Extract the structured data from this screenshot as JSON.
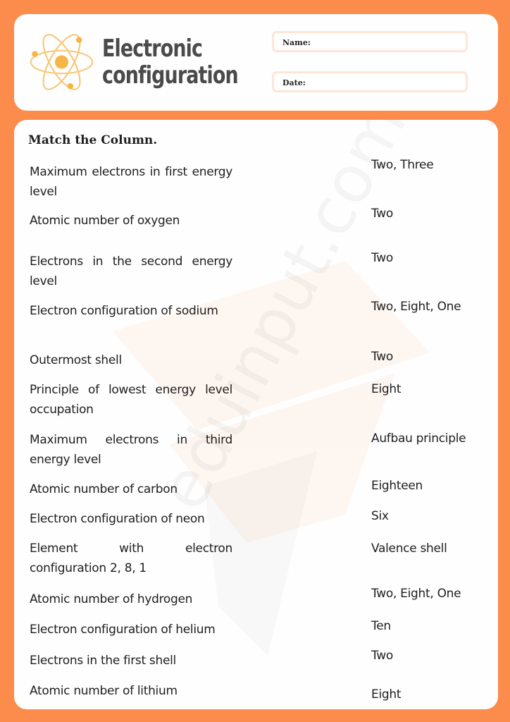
{
  "header": {
    "title_line1": "Electronic",
    "title_line2": "configuration",
    "name_label": "Name:",
    "date_label": "Date:"
  },
  "colors": {
    "background": "#fc8c4c",
    "card": "#fefefe",
    "logo": "#f7b547",
    "title_text": "#4a4a4a",
    "field_border": "#fde6d6"
  },
  "worksheet": {
    "title": "Match the Column.",
    "watermark": "eduinput.com",
    "left_column": [
      "Maximum electrons in first energy level",
      "Atomic number of oxygen",
      "Electrons in the second energy level",
      "Electron configuration of sodium",
      "Outermost shell",
      "Principle of lowest energy level occupation",
      "Maximum electrons in third energy level",
      "Atomic number of carbon",
      "Electron configuration of neon",
      "Element with electron configuration 2, 8, 1",
      "Atomic number of hydrogen",
      "Electron configuration of helium",
      "Electrons in the first shell",
      "Atomic number of lithium"
    ],
    "right_column": [
      "Two, Three",
      "Two",
      "Two",
      "Two, Eight, One",
      "Two",
      "Eight",
      "Aufbau principle",
      "Eighteen",
      "Six",
      "Valence shell",
      "Two, Eight, One",
      "Ten",
      "Two",
      "Eight"
    ]
  }
}
